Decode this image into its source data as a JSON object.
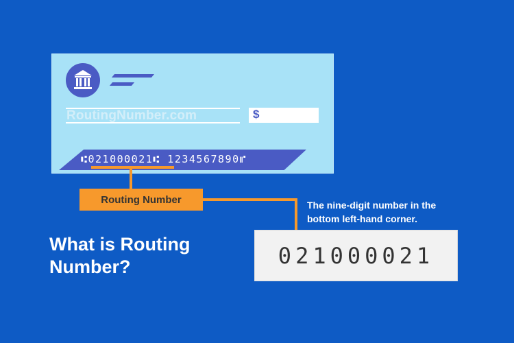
{
  "check": {
    "website": "RoutingNumber.com",
    "currency_symbol": "$",
    "bank_icon_label": "BANK",
    "micr_line": "⑆021000021⑆ 1234567890⑈"
  },
  "callout": {
    "label": "Routing Number",
    "description": "The nine-digit number in the bottom left-hand corner.",
    "routing_number": "021000021"
  },
  "title": "What is Routing Number?",
  "colors": {
    "background": "#0e5bc5",
    "check": "#a8e2f7",
    "accent": "#4a5bc4",
    "highlight": "#f7992c"
  }
}
